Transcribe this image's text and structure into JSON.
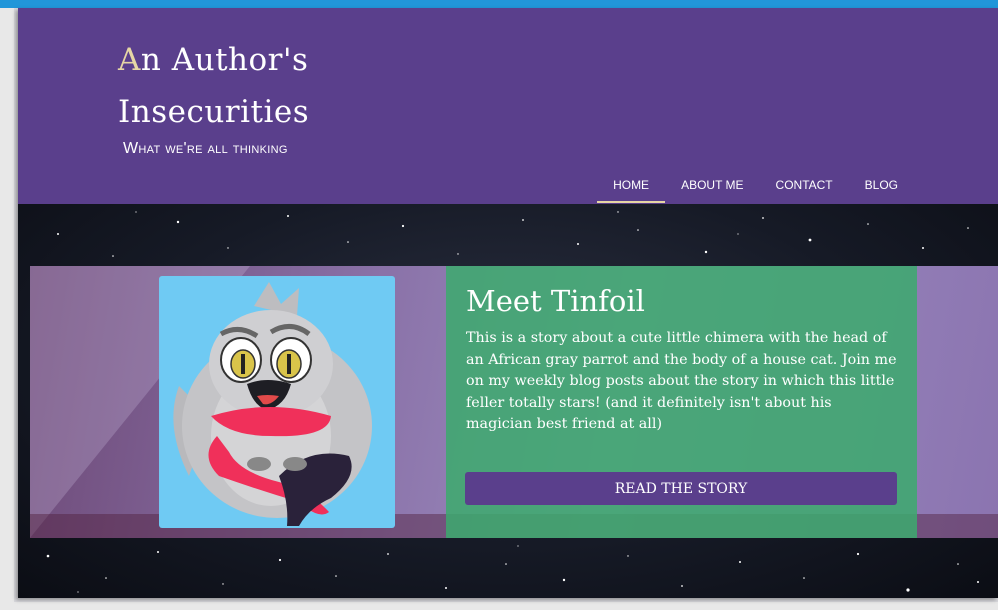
{
  "header": {
    "title_cap": "A",
    "title_rest": "n Author's Insecurities",
    "tagline": "What we're all thinking"
  },
  "nav": {
    "items": [
      {
        "label": "HOME",
        "active": true
      },
      {
        "label": "ABOUT ME",
        "active": false
      },
      {
        "label": "CONTACT",
        "active": false
      },
      {
        "label": "BLOG",
        "active": false
      }
    ]
  },
  "feature": {
    "title": "Meet Tinfoil",
    "body": "This is a story about a cute little chimera with the head of an African gray parrot and the body of a house cat. Join me on my weekly blog posts about the story in which this little feller totally stars! (and it definitely isn't about his magician best friend at all)",
    "button_label": "READ THE STORY"
  },
  "colors": {
    "header_bg": "#5a3f8c",
    "accent_gold": "#e6d6a5",
    "card_green": "#3caa6e",
    "button_purple": "#5a3f8c",
    "browser_accent": "#2196d9"
  }
}
